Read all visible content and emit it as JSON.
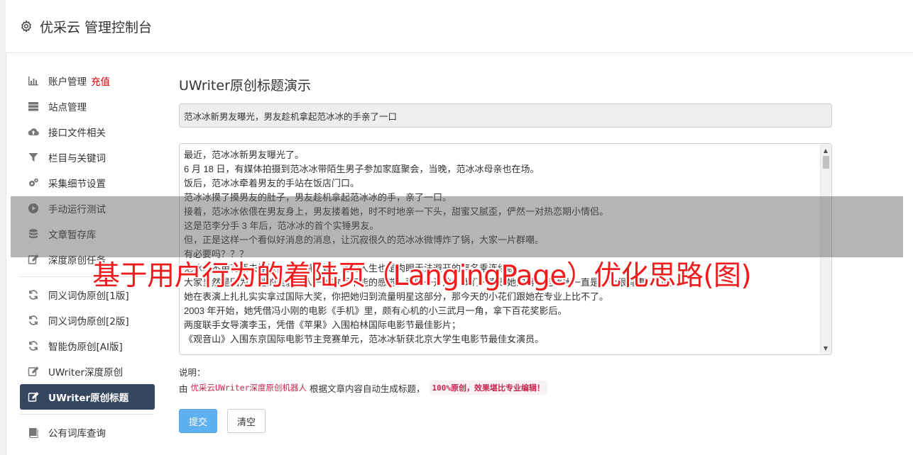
{
  "header": {
    "title": "优采云 管理控制台",
    "icon": "gear-icon"
  },
  "sidebar": {
    "group1": [
      {
        "label": "账户管理",
        "extra": "充值",
        "icon": "bar-chart-icon"
      },
      {
        "label": "站点管理",
        "icon": "server-icon"
      },
      {
        "label": "接口文件相关",
        "icon": "cloud-upload-icon"
      },
      {
        "label": "栏目与关键词",
        "icon": "filter-icon"
      },
      {
        "label": "采集细节设置",
        "icon": "cogs-icon"
      },
      {
        "label": "手动运行测试",
        "icon": "play-circle-icon"
      },
      {
        "label": "文章暂存库",
        "icon": "database-icon"
      },
      {
        "label": "深度原创任务",
        "icon": "edit-icon"
      }
    ],
    "group2": [
      {
        "label": "同义词伪原创[1版]",
        "icon": "refresh-icon"
      },
      {
        "label": "同义词伪原创[2版]",
        "icon": "refresh-icon"
      },
      {
        "label": "智能伪原创[AI版]",
        "icon": "refresh-icon"
      },
      {
        "label": "UWriter深度原创",
        "icon": "edit-icon"
      },
      {
        "label": "UWriter原创标题",
        "icon": "edit-icon",
        "active": true
      }
    ],
    "group3": [
      {
        "label": "公有词库查询",
        "icon": "book-icon"
      }
    ]
  },
  "main": {
    "heading": "UWriter原创标题演示",
    "title_value": "范冰冰新男友曝光，男友趁机拿起范冰冰的手亲了一口",
    "article_lines": [
      "最近，范冰冰新男友曝光了。",
      "6 月 18 日，有媒体拍摄到范冰冰带陌生男子参加家庭聚会，当晚，范冰冰母亲也在场。",
      "饭后，范冰冰牵着男友的手站在饭店门口。",
      "范冰冰摸了摸男友的肚子，男友趁机拿起范冰冰的手，亲了一口。",
      "接着，范冰冰依偎在男友身上，男友搂着她，时不时地亲一下头，甜蜜又腻歪，俨然一对热恋期小情侣。",
      "这是范李分手 3 年后，范冰冰的首个实锤男友。",
      "但，正是这样一个看似好消息的消息，让沉寂很久的范冰冰微博炸了锅，大家一片群嘲。",
      "有必要吗？？？",
      "范冰冰不用花瓶去挣钱，从出道开始，她的人生也是肉眼无法避开的声名乘连续剧",
      "大家当然是因为，她的美貌给人一种欲罢不能的感觉，而唯一开始，我们一直是她的男，范冰冰一直是一个很有事业心的人",
      "她在表演上扎扎实实拿过国际大奖，你把她归到流量明星这部分，那今天的小花们跟她在专业上比不了。",
      "2003 年开始，她凭借冯小刚的电影《手机》里，颇有心机的小三武月一角，拿下百花奖影后。",
      "两度联手女导演李玉，凭借《苹果》入围柏林国际电影节最佳影片；",
      "《观音山》入围东京国际电影节主竞赛单元，范冰冰斩获北京大学生电影节最佳女演员。"
    ],
    "note_label": "说明：",
    "note_prefix": "由",
    "note_tool": "优采云UWriter深度原创机器人",
    "note_mid": "根据文章内容自动生成标题，",
    "note_badge": "100%原创，效果堪比专业编辑！",
    "submit_label": "提交",
    "clear_label": "清空"
  },
  "watermark": "基于用户行为的着陆页（LangingPage）优化思路(图)",
  "colors": {
    "active_bg": "#35475f",
    "submit_bg": "#5eb0ef",
    "accent_red": "#c7254e",
    "watermark": "#ee1c1c"
  }
}
